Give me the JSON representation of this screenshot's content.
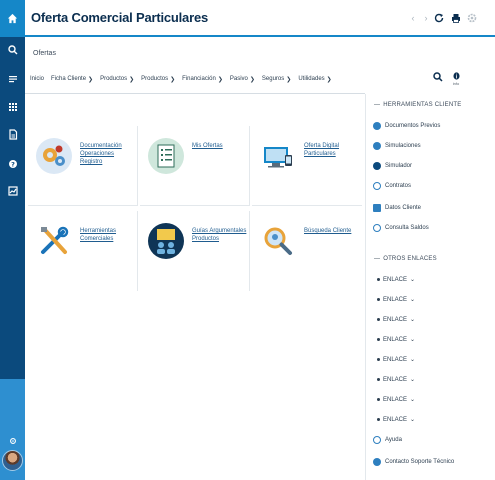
{
  "header": {
    "title": "Oferta Comercial Particulares"
  },
  "breadcrumb": "Ofertas",
  "tabs": [
    {
      "label": "Inicio"
    },
    {
      "label": "Ficha Cliente"
    },
    {
      "label": "Productos"
    },
    {
      "label": "Productos"
    },
    {
      "label": "Financiación"
    },
    {
      "label": "Pasivo"
    },
    {
      "label": "Seguros"
    },
    {
      "label": "Utilidades"
    }
  ],
  "toolbar": {
    "info_label": "info"
  },
  "tiles": [
    {
      "label": "Documentación Operaciones Registro"
    },
    {
      "label": "Mis Ofertas"
    },
    {
      "label": "Oferta Digital Particulares"
    },
    {
      "label": "Herramientas Comerciales"
    },
    {
      "label": "Guías Argumentales Productos"
    },
    {
      "label": "Búsqueda Cliente"
    }
  ],
  "right_panel": {
    "section1_title": "HERRAMIENTAS CLIENTE",
    "section1_items": [
      {
        "label": "Documentos Previos"
      },
      {
        "label": "Simulaciones"
      },
      {
        "label": "Simulador"
      },
      {
        "label": "Contratos"
      },
      {
        "label": "Datos Cliente"
      },
      {
        "label": "Consulta Saldos"
      }
    ],
    "section2_title": "OTROS ENLACES",
    "section2_items": [
      {
        "label": "ENLACE"
      },
      {
        "label": "ENLACE"
      },
      {
        "label": "ENLACE"
      },
      {
        "label": "ENLACE"
      },
      {
        "label": "ENLACE"
      },
      {
        "label": "ENLACE"
      },
      {
        "label": "ENLACE"
      },
      {
        "label": "ENLACE"
      }
    ],
    "footer_items": [
      {
        "label": "Ayuda"
      },
      {
        "label": "Contacto Soporte Técnico"
      }
    ]
  },
  "colors": {
    "rail": "#0b4a7d",
    "accent": "#1587c8",
    "link": "#1f5c8f"
  }
}
